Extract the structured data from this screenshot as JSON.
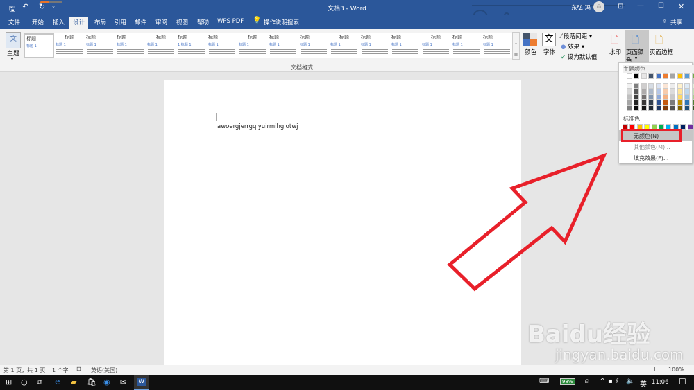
{
  "titlebar": {
    "doc_title": "文档3 - Word",
    "user": "东弘 冯",
    "share": "共享"
  },
  "tabs": [
    "文件",
    "开始",
    "插入",
    "设计",
    "布局",
    "引用",
    "邮件",
    "审阅",
    "视图",
    "帮助",
    "WPS PDF"
  ],
  "active_tab": "设计",
  "tell_me": "操作说明搜索",
  "ribbon": {
    "theme_label": "主题",
    "style_gallery": [
      {
        "title": "标题",
        "heading": "标题 1"
      },
      {
        "title": "标题",
        "heading": "标题 1"
      },
      {
        "title": "标题",
        "heading": "标题 1"
      },
      {
        "title": "标题",
        "heading": "标题 1"
      },
      {
        "title": "标题",
        "heading": "标题 1"
      },
      {
        "title": "标题",
        "heading": "1 标题 1"
      },
      {
        "title": "标题",
        "heading": "标题 1"
      },
      {
        "title": "标题",
        "heading": "标题 1"
      },
      {
        "title": "标题",
        "heading": "标题 1"
      },
      {
        "title": "标题",
        "heading": "标题 1"
      },
      {
        "title": "标题",
        "heading": "标题 1"
      },
      {
        "title": "标题",
        "heading": "标题 1"
      },
      {
        "title": "标题",
        "heading": "标题 1"
      },
      {
        "title": "标题",
        "heading": "标题 1"
      },
      {
        "title": "标题",
        "heading": "标题 1"
      },
      {
        "title": "标题",
        "heading": "标题 1"
      }
    ],
    "group_label": "文档格式",
    "colors_label": "颜色",
    "fonts_label": "字体",
    "paragraph_spacing": "段落间距",
    "effects": "效果",
    "set_default": "设为默认值",
    "watermark": "水印",
    "page_color": "页面颜色",
    "page_borders": "页面边框"
  },
  "document": {
    "text": "awoergjerrgqiyuirmihgiotwj"
  },
  "page_color_menu": {
    "theme_colors_label": "主题颜色",
    "theme_colors": [
      "#ffffff",
      "#000000",
      "#e7e6e6",
      "#44546a",
      "#4472c4",
      "#ed7d31",
      "#a5a5a5",
      "#ffc000",
      "#5b9bd5",
      "#70ad47"
    ],
    "theme_shades": [
      [
        "#f2f2f2",
        "#d9d9d9",
        "#bfbfbf",
        "#a6a6a6",
        "#808080"
      ],
      [
        "#808080",
        "#595959",
        "#404040",
        "#262626",
        "#0d0d0d"
      ],
      [
        "#d0cece",
        "#aeabab",
        "#757171",
        "#3a3838",
        "#171616"
      ],
      [
        "#d6dce4",
        "#adb9ca",
        "#8497b0",
        "#333f4f",
        "#222a35"
      ],
      [
        "#d9e2f3",
        "#b4c6e7",
        "#8eaadb",
        "#2f5496",
        "#1f3864"
      ],
      [
        "#fbe5d5",
        "#f7cbac",
        "#f4b183",
        "#c55a11",
        "#833c0b"
      ],
      [
        "#ededed",
        "#dbdbdb",
        "#c9c9c9",
        "#7b7b7b",
        "#525252"
      ],
      [
        "#fff2cc",
        "#fee599",
        "#ffd965",
        "#bf9000",
        "#7f6000"
      ],
      [
        "#deebf6",
        "#bdd7ee",
        "#9cc3e5",
        "#2e75b5",
        "#1e4e79"
      ],
      [
        "#e2efd9",
        "#c5e0b3",
        "#a8d08d",
        "#538135",
        "#375623"
      ]
    ],
    "standard_colors_label": "标准色",
    "standard_colors": [
      "#c00000",
      "#ff0000",
      "#ffc000",
      "#ffff00",
      "#92d050",
      "#00b050",
      "#00b0f0",
      "#0070c0",
      "#002060",
      "#7030a0"
    ],
    "items": [
      "无颜色(N)",
      "其他颜色(M)...",
      "填充效果(F)..."
    ],
    "highlighted_item": "无颜色(N)"
  },
  "status": {
    "page": "第 1 页，共 1 页",
    "words": "1 个字",
    "language": "英语(美国)",
    "zoom": "100%"
  },
  "taskbar": {
    "battery": "98%",
    "ime": "英",
    "time": "11:06"
  },
  "watermark": {
    "brand": "Baidu经验",
    "url": "jingyan.baidu.com"
  },
  "colors": {
    "word_blue": "#2b579a",
    "annotation_red": "#e8202a"
  }
}
